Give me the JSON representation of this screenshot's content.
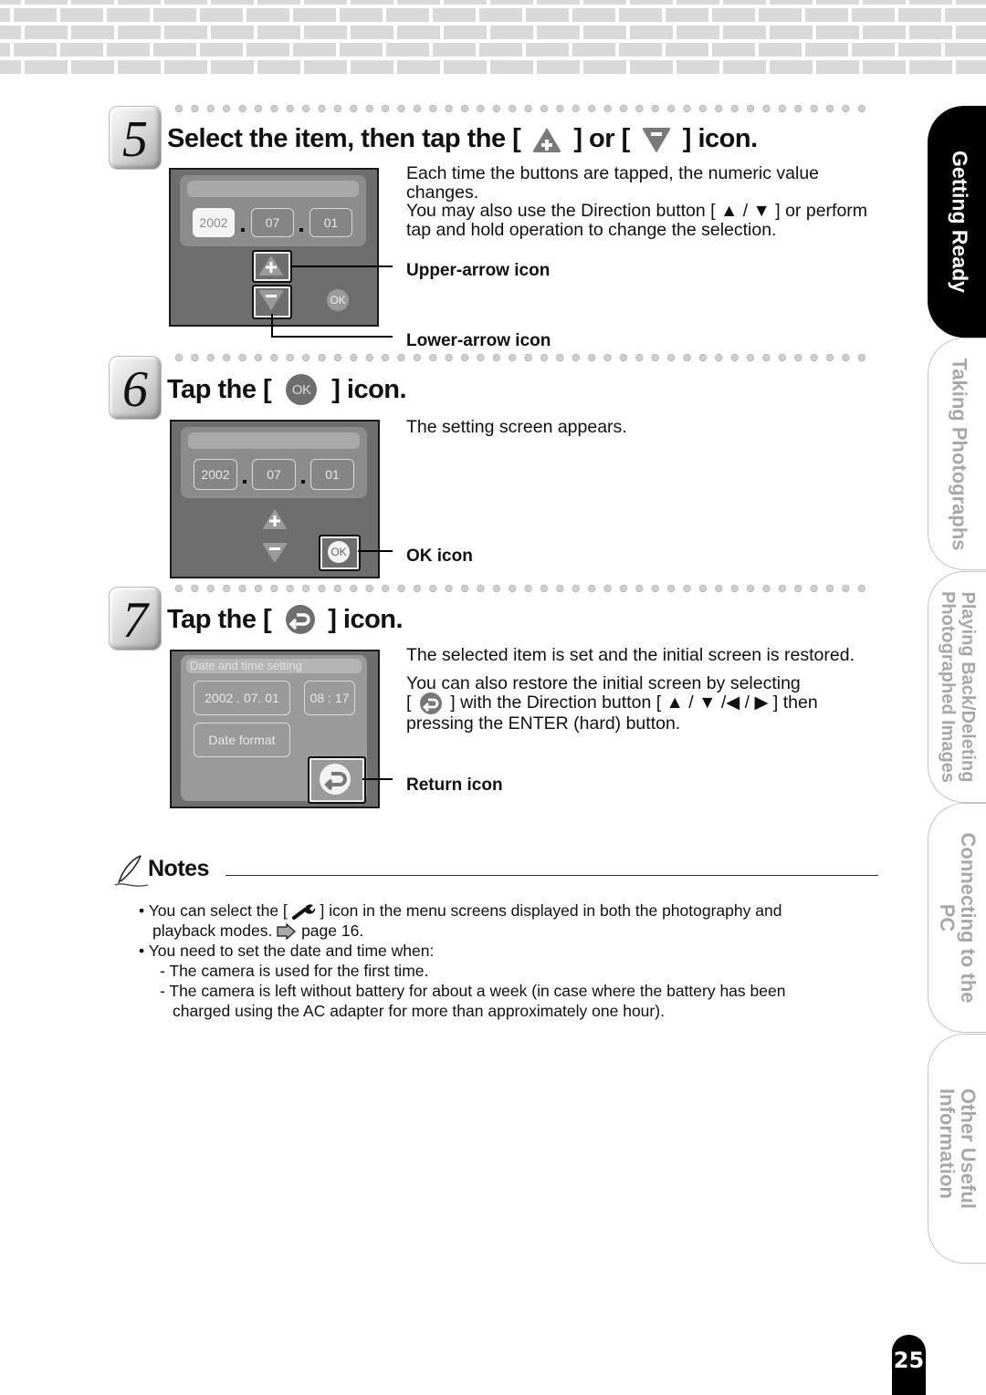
{
  "steps": [
    {
      "number": "5",
      "title_parts": [
        "Select the item, then tap the [",
        "] or [",
        "] icon."
      ],
      "title_icons": [
        "plus-triangle-icon",
        "minus-triangle-icon"
      ],
      "body": [
        "Each time the buttons are tapped, the numeric value changes.",
        "You may also use the Direction button [ ▲ / ▼ ] or perform tap and hold operation to change the selection."
      ],
      "callouts": [
        "Upper-arrow icon",
        "Lower-arrow icon"
      ],
      "screen": {
        "fields": [
          "2002",
          "07",
          "01"
        ],
        "selected_field": "2002",
        "plus": "+",
        "minus": "−",
        "ok": "OK"
      }
    },
    {
      "number": "6",
      "title_parts": [
        "Tap the [",
        "] icon."
      ],
      "title_icon_label": "OK",
      "body": [
        "The setting screen appears."
      ],
      "callouts": [
        "OK icon"
      ],
      "screen": {
        "fields": [
          "2002",
          "07",
          "01"
        ],
        "plus": "+",
        "minus": "−",
        "ok": "OK"
      }
    },
    {
      "number": "7",
      "title_parts": [
        "Tap the [",
        "] icon."
      ],
      "title_icon": "return-icon",
      "body": [
        "The selected item is set and the initial screen is restored.",
        "You can also restore the initial screen by selecting",
        "] with the Direction button [ ▲ / ▼ /◀ / ▶ ] then pressing the ENTER (hard) button."
      ],
      "body_bracket_open": "[",
      "callouts": [
        "Return icon"
      ],
      "screen": {
        "title": "Date and time setting",
        "date": "2002 . 07. 01",
        "time": "08 : 17",
        "date_format": "Date format"
      }
    }
  ],
  "notes": {
    "title": "Notes",
    "items": [
      {
        "bullet": "•",
        "text_before": "You can select the [",
        "icon": "wrench-icon",
        "text_after": "] icon in the menu screens displayed in both the photography and",
        "line2": "playback modes.",
        "ref": "page 16."
      },
      {
        "bullet": "•",
        "text": "You need to set the date and time when:"
      }
    ],
    "subitems": [
      {
        "dash": "-",
        "text": "The camera is used for the first time."
      },
      {
        "dash": "-",
        "text": "The camera is left without battery for about a week (in case where the battery has been",
        "line2": "charged using the AC adapter for more than approximately one hour)."
      }
    ]
  },
  "side_tabs": [
    {
      "label": "Getting Ready",
      "active": true
    },
    {
      "label": "Taking Photographs",
      "active": false
    },
    {
      "label": "Playing Back/Deleting\nPhotographed Images",
      "active": false
    },
    {
      "label": "Connecting to the\nPC",
      "active": false
    },
    {
      "label": "Other Useful\nInformation",
      "active": false
    }
  ],
  "page_number": "25",
  "colors": {
    "active_tab": "#000000",
    "inactive_tab_text": "#a8a8a8",
    "screen_bg": "#6e6e6e",
    "brick": "#d9d9d9"
  }
}
